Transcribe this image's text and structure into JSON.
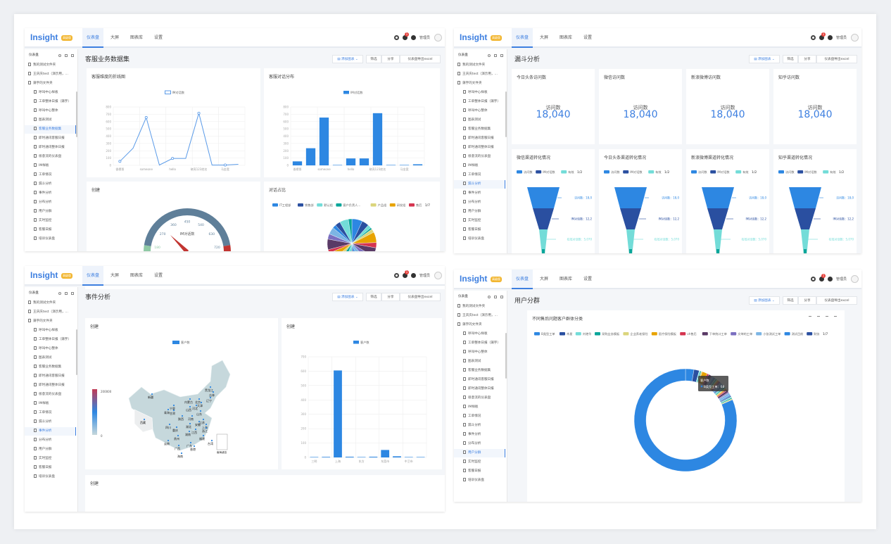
{
  "colors": {
    "accent": "#3d7fe0",
    "palette": [
      "#2d87e2",
      "#2a4fa0",
      "#73dcd8",
      "#0aa69a",
      "#dbd57c",
      "#e8a300",
      "#d5344f",
      "#5a3a66",
      "#7b6fc0",
      "#7cb5e4"
    ],
    "gauge_band": "#5f7f99",
    "gauge_low": "#8fc9a5",
    "gauge_high": "#c23531"
  },
  "header": {
    "logo": "Insight",
    "badge": "高级版",
    "tabs": [
      "仪表盘",
      "大屏",
      "图表库",
      "设置"
    ],
    "active_tab": 0,
    "icons": [
      "gear-icon",
      "bell-icon",
      "help-icon"
    ],
    "notification_count": "1",
    "user": "管理员"
  },
  "sidebar": {
    "title": "仪表盘",
    "icons": [
      "search-icon",
      "plus-icon",
      "more-icon"
    ],
    "folders": [
      "我的测试文件夹",
      "王庆庆test（演示用，...",
      "蒲宇的文件夹"
    ],
    "items": [
      "呼叫中心样板",
      "工单整体日报（蒲宇）",
      "呼叫中心整体",
      "图表测试",
      "客服业务数据集",
      "即时通讯客服日报",
      "即时通讯整体日报",
      "很意流的仪表盘",
      "IM样板",
      "工单情况",
      "漏斗分析",
      "事件分析",
      "分布分析",
      "用户分群",
      "实时监控",
      "客服日报",
      "培训仪表盘"
    ]
  },
  "toolbar": {
    "add_chart": "添加图表",
    "filter": "筛选",
    "share": "分享",
    "export": "仪表盘导出excel"
  },
  "panels": [
    {
      "title": "客服业务数据集",
      "active_item": 4,
      "cards": [
        {
          "title": "客服维度的折线图",
          "chart_data": {
            "type": "line",
            "legend": [
              "IM对话数"
            ],
            "categories": [
              "香槟哥",
              "",
              "someone",
              "",
              "hello",
              "",
              "晓亮123姓名",
              "",
              "马金宽",
              ""
            ],
            "values": [
              55,
              235,
              655,
              5,
              95,
              95,
              715,
              5,
              5,
              15
            ],
            "ylim": [
              0,
              800
            ],
            "yticks": [
              0,
              100,
              200,
              300,
              400,
              500,
              600,
              700,
              800
            ]
          }
        },
        {
          "title": "客服对话分布",
          "chart_data": {
            "type": "bar",
            "legend": [
              "IM对话数"
            ],
            "categories": [
              "香槟哥",
              "",
              "someone",
              "",
              "hello",
              "",
              "晓亮123姓名",
              "",
              "马金宽",
              ""
            ],
            "values": [
              55,
              235,
              655,
              5,
              95,
              95,
              715,
              5,
              5,
              15
            ],
            "ylim": [
              0,
              800
            ],
            "yticks": [
              0,
              100,
              200,
              300,
              400,
              500,
              600,
              700,
              800
            ]
          }
        },
        {
          "title": "创建",
          "chart_data": {
            "type": "gauge",
            "name": "IM对话数",
            "min": 0,
            "max": 900,
            "value": 300,
            "ticks": [
              180,
              270,
              360,
              450,
              540,
              630,
              720
            ]
          }
        },
        {
          "title": "对话占比",
          "chart_data": {
            "type": "pie",
            "legend": [
              "IT工程部",
              "销售部",
              "默认组",
              "客户负责人...",
              "产品组",
              "研发组",
              "售后"
            ],
            "legend_page": "1/7",
            "values": [
              6,
              4,
              2,
              1,
              2,
              6,
              3,
              5,
              4,
              5,
              3,
              2,
              5,
              4,
              3,
              4,
              2,
              6,
              3,
              4,
              2,
              3,
              5,
              2
            ]
          }
        }
      ]
    },
    {
      "title": "漏斗分析",
      "active_item": 10,
      "kpis": [
        {
          "title": "今日头条访问数",
          "label": "访问数",
          "value": "18,040"
        },
        {
          "title": "微信访问数",
          "label": "访问数",
          "value": "18,040"
        },
        {
          "title": "新浪微博访问数",
          "label": "访问数",
          "value": "18,040"
        },
        {
          "title": "知乎访问数",
          "label": "访问数",
          "value": "18,040"
        }
      ],
      "funnels": [
        {
          "title": "微信渠道转化情况"
        },
        {
          "title": "今日头条渠道转化情况"
        },
        {
          "title": "新浪微博渠道转化情况"
        },
        {
          "title": "知乎渠道转化情况"
        }
      ],
      "funnel_chart": {
        "type": "funnel",
        "legend": [
          "访问数",
          "IM对话数",
          "有效"
        ],
        "legend_page": "1/2",
        "stages": [
          {
            "name": "访问数",
            "label": "访问数：18,0",
            "value": 18040
          },
          {
            "name": "IM对话数",
            "label": "IM对话数：12,2",
            "value": 12200
          },
          {
            "name": "有效对话数",
            "label": "有效对话数：5,070",
            "value": 5070
          }
        ]
      }
    },
    {
      "title": "事件分析",
      "active_item": 11,
      "cards": [
        {
          "title": "创建",
          "chart_data": {
            "type": "map",
            "legend": [
              "客户数"
            ],
            "visual_range": [
              "0",
              "200000"
            ],
            "regions": [
              "新疆",
              "西藏",
              "黑龙江",
              "吉林",
              "辽宁",
              "内蒙古",
              "北京",
              "天津",
              "河北",
              "宁夏",
              "青海",
              "甘肃",
              "山西",
              "山东",
              "陕西",
              "河南",
              "江苏",
              "安徽",
              "上海",
              "四川",
              "重庆",
              "湖北",
              "浙江",
              "湖南",
              "江西",
              "贵州",
              "福建",
              "云南",
              "广西",
              "广东",
              "台湾",
              "香港",
              "海南"
            ],
            "inset": "南海诸岛"
          }
        },
        {
          "title": "创建",
          "chart_data": {
            "type": "bar",
            "legend": [
              "客户数"
            ],
            "categories": [
              "三明",
              "",
              "上海",
              "",
              "东方",
              "",
              "东莞市",
              "",
              "中卫市",
              ""
            ],
            "values": [
              3,
              4,
              605,
              5,
              2,
              5,
              52,
              8,
              2,
              3
            ],
            "ylim": [
              0,
              700
            ],
            "yticks": [
              0,
              100,
              200,
              300,
              400,
              500,
              600,
              700
            ]
          }
        },
        {
          "title": "创建"
        }
      ]
    },
    {
      "title": "用户分群",
      "active_item": 13,
      "cards": [
        {
          "title": "不同售后问题客户群体分类",
          "tools": [
            "edit-icon",
            "filter-icon",
            "expand-icon",
            "more-icon"
          ],
          "chart_data": {
            "type": "donut",
            "legend": [
              "B类型工单",
              "木星",
              "刘艳华",
              "采购业务模板",
              "企业养老保险",
              "医疗保险模板",
              "vh售后",
              "下单统计工单",
              "文坤的工单",
              "小张测试工单",
              "测试目前",
              "财务"
            ],
            "legend_page": "1/7",
            "values": [
              8,
              5,
              1,
              1,
              1,
              5,
              1.5,
              3,
              1,
              1,
              1,
              1,
              1,
              1,
              1,
              1,
              1,
              1,
              1,
              1.5,
              1,
              1,
              1.5,
              1,
              1,
              1,
              1,
              2,
              1,
              2,
              1,
              1,
              1,
              1,
              1,
              245
            ],
            "tooltip": {
              "title": "客户数",
              "item": "B类型工单：68"
            }
          }
        }
      ]
    }
  ]
}
